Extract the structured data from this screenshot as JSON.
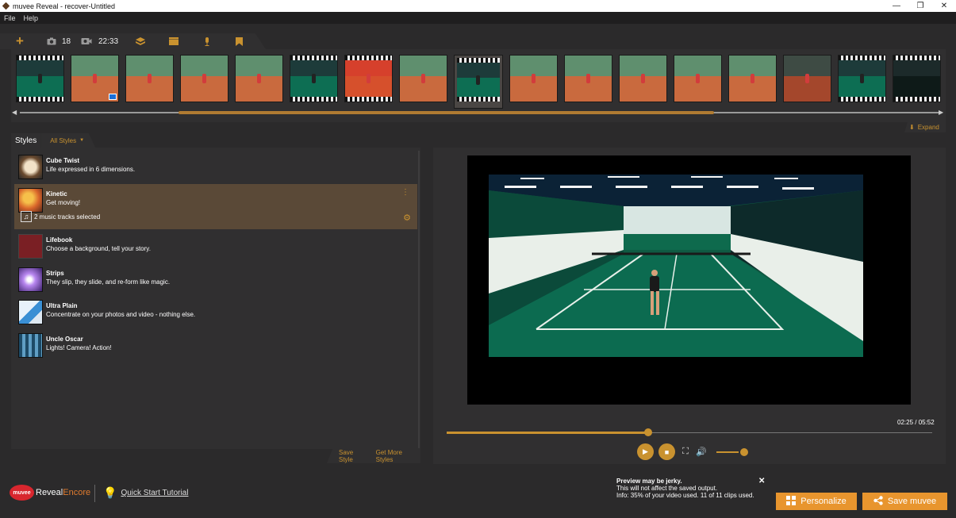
{
  "window": {
    "title": "muvee Reveal - recover-Untitled",
    "minimize": "—",
    "restore": "❐",
    "close": "✕"
  },
  "menu": {
    "file": "File",
    "help": "Help"
  },
  "toolbar": {
    "add_icon": "plus-icon",
    "photo_count": "18",
    "video_duration": "22:33"
  },
  "filmstrip": {
    "thumbs": [
      {
        "type": "indoor"
      },
      {
        "type": "clay",
        "badge": true
      },
      {
        "type": "clay"
      },
      {
        "type": "clay"
      },
      {
        "type": "clay"
      },
      {
        "type": "indoor"
      },
      {
        "type": "clay-red"
      },
      {
        "type": "clay"
      },
      {
        "type": "indoor",
        "selected": true
      },
      {
        "type": "clay"
      },
      {
        "type": "clay"
      },
      {
        "type": "clay"
      },
      {
        "type": "clay"
      },
      {
        "type": "clay"
      },
      {
        "type": "clay-dark"
      },
      {
        "type": "indoor"
      },
      {
        "type": "dark"
      }
    ],
    "expand_label": "Expand"
  },
  "styles": {
    "tab_label": "Styles",
    "filter_label": "All Styles",
    "items": [
      {
        "name": "Cube Twist",
        "desc": "Life expressed in 6 dimensions."
      },
      {
        "name": "Kinetic",
        "desc": "Get moving!",
        "music": "2 music tracks selected"
      },
      {
        "name": "Lifebook",
        "desc": "Choose a background, tell your story."
      },
      {
        "name": "Strips",
        "desc": "They slip, they slide, and re-form like magic."
      },
      {
        "name": "Ultra Plain",
        "desc": "Concentrate on your photos and video - nothing else."
      },
      {
        "name": "Uncle Oscar",
        "desc": "Lights! Camera! Action!"
      }
    ],
    "save_style": "Save Style",
    "get_more": "Get More Styles"
  },
  "preview": {
    "timecode": "02:25 / 05:52",
    "progress": 0.415,
    "volume": 0.8
  },
  "brand": {
    "muvee": "muvee",
    "reveal": "Reveal",
    "encore": "Encore"
  },
  "tutorial": {
    "label": "Quick Start Tutorial"
  },
  "notice": {
    "title": "Preview may be jerky.",
    "line1": "This will not affect the saved output.",
    "line2": "Info: 35% of your video used. 11 of 11 clips used.",
    "close": "✕"
  },
  "actions": {
    "personalize": "Personalize",
    "save": "Save muvee"
  },
  "colors": {
    "accent": "#c9922f",
    "button": "#e8952e",
    "panel": "#302f30",
    "bg": "#2b2a2b"
  }
}
